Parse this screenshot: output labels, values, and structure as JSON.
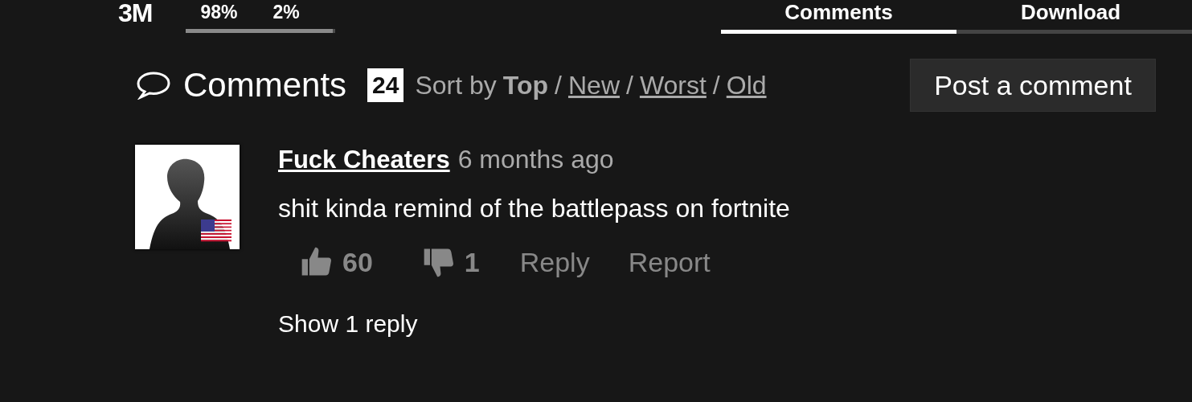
{
  "stats": {
    "views": "3M",
    "likes_percent": "98%",
    "dislikes_percent": "2%",
    "level": 0.98
  },
  "tabs": [
    {
      "label": "Comments",
      "selected": true
    },
    {
      "label": "Download",
      "selected": false
    }
  ],
  "comments_header": {
    "title": "Comments",
    "count": "24",
    "sort_label": "Sort by",
    "sort_options": [
      {
        "label": "Top",
        "selected": true
      },
      {
        "label": "New",
        "selected": false
      },
      {
        "label": "Worst",
        "selected": false
      },
      {
        "label": "Old",
        "selected": false
      }
    ],
    "separator": "/",
    "post_button": "Post a comment"
  },
  "comments": [
    {
      "author": "Fuck Cheaters",
      "time": "6 months ago",
      "text": "shit kinda remind of the battlepass on fortnite",
      "likes": "60",
      "dislikes": "1",
      "actions": [
        "Reply",
        "Report"
      ],
      "show_replies": "Show 1 reply"
    }
  ]
}
